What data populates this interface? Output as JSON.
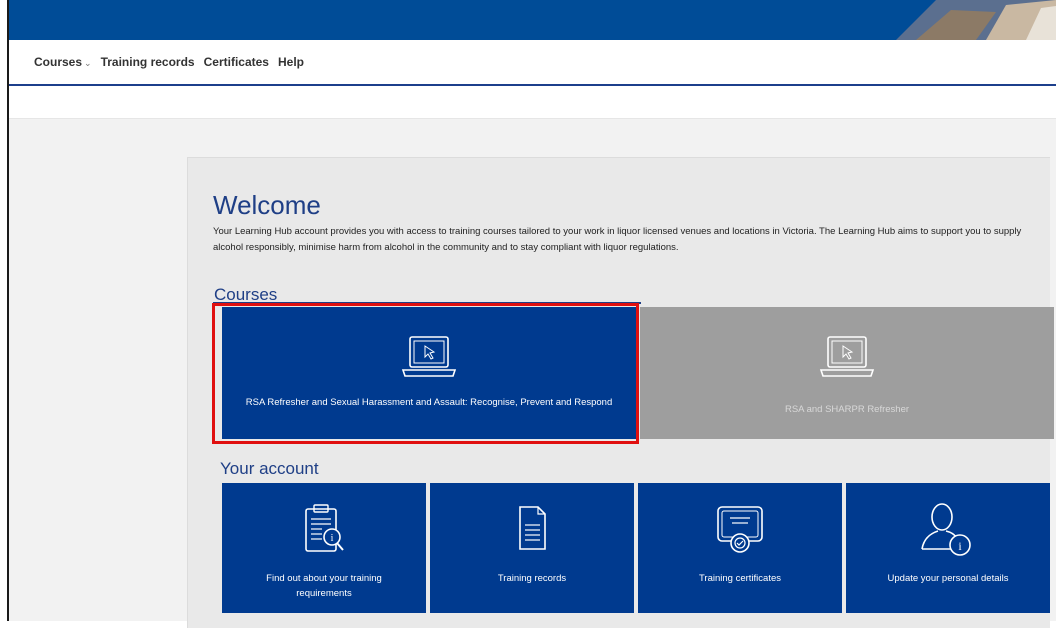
{
  "nav": {
    "courses": "Courses",
    "courses_caret": "⌄",
    "training_records": "Training records",
    "certificates": "Certificates",
    "help": "Help"
  },
  "welcome": {
    "title": "Welcome",
    "intro": "Your Learning Hub account provides you with access to training courses tailored to your work in liquor licensed venues and locations in Victoria. The Learning Hub aims to support you to supply alcohol responsibly, minimise harm from alcohol in the community and to stay compliant with liquor regulations."
  },
  "courses": {
    "heading": "Courses",
    "items": [
      {
        "label": "RSA Refresher and Sexual Harassment and Assault: Recognise, Prevent and Respond",
        "icon": "laptop-icon"
      },
      {
        "label": "RSA and SHARPR Refresher",
        "icon": "laptop-icon"
      }
    ]
  },
  "account": {
    "heading": "Your account",
    "items": [
      {
        "label": "Find out about your training requirements",
        "icon": "clipboard-search-icon"
      },
      {
        "label": "Training records",
        "icon": "document-icon"
      },
      {
        "label": "Training certificates",
        "icon": "certificate-icon"
      },
      {
        "label": "Update your personal details",
        "icon": "user-info-icon"
      }
    ]
  },
  "colors": {
    "primary": "#003a8f",
    "topbar": "#004c97",
    "disabled_tile": "#9e9e9e",
    "highlight": "#e01010"
  }
}
